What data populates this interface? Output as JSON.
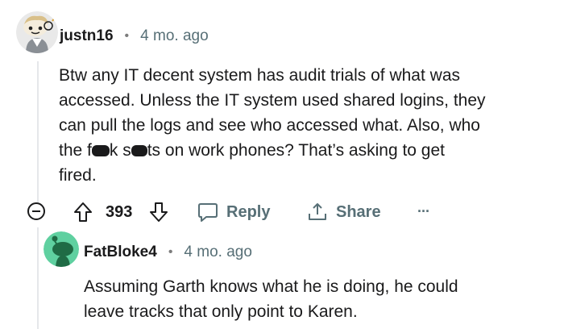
{
  "comment": {
    "username": "justn16",
    "separator": "•",
    "timestamp": "4 mo. ago",
    "body_lines": [
      "Btw any IT decent system has audit trials of what was",
      "accessed. Unless the IT system used shared logins, they",
      "can pull the logs and see who accessed what. Also, who"
    ],
    "line4_part1": "the f",
    "line4_part2": "k s",
    "line4_part3": "ts on work phones? That’s asking to get",
    "line5": "fired.",
    "vote_count": "393",
    "reply_label": "Reply",
    "share_label": "Share",
    "more_label": "···"
  },
  "reply": {
    "username": "FatBloke4",
    "separator": "•",
    "timestamp": "4 mo. ago",
    "body_lines": [
      "Assuming Garth knows what he is doing, he could",
      "leave tracks that only point to Karen."
    ]
  },
  "colors": {
    "text": "#1a1a1b",
    "meta": "#576f76",
    "reply_avatar_bg": "#5fd0a0",
    "snoo_body": "#1f6b45"
  }
}
